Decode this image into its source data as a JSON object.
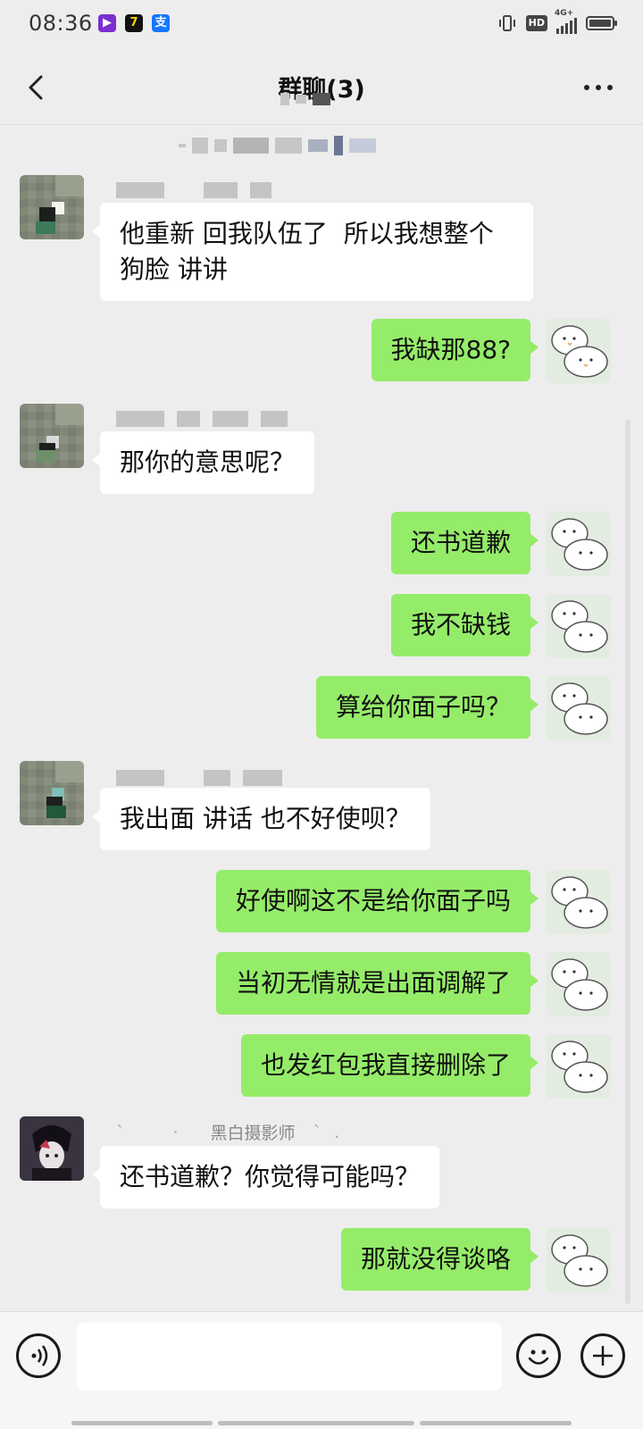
{
  "status_bar": {
    "time": "08:36",
    "app_icons": [
      "video-app-icon",
      "seven-app-icon",
      "alipay-icon"
    ],
    "indicators": [
      "vibrate-icon",
      "hd-icon",
      "4g-signal-icon",
      "battery-icon"
    ],
    "hd_label": "HD",
    "network_label": "4G+"
  },
  "header": {
    "title": "群聊(3)",
    "back_icon": "chevron-left-icon",
    "more_icon": "more-dots-icon"
  },
  "messages": [
    {
      "side": "in",
      "name_visible": false,
      "text": "他重新 回我队伍了  所以我想整个狗脸 讲讲"
    },
    {
      "side": "out",
      "text": "我缺那88?"
    },
    {
      "side": "in",
      "name_visible": false,
      "text": "那你的意思呢？"
    },
    {
      "side": "out",
      "text": "还书道歉"
    },
    {
      "side": "out",
      "text": "我不缺钱"
    },
    {
      "side": "out",
      "text": "算给你面子吗？"
    },
    {
      "side": "in",
      "name_visible": false,
      "text": "我出面 讲话 也不好使呗？"
    },
    {
      "side": "out",
      "text": "好使啊这不是给你面子吗"
    },
    {
      "side": "out",
      "text": "当初无情就是出面调解了"
    },
    {
      "side": "out",
      "text": "也发红包我直接删除了"
    },
    {
      "side": "in",
      "name": "黑白摄影师",
      "text": "还书道歉？你觉得可能吗？"
    },
    {
      "side": "out",
      "text": "那就没得谈咯"
    }
  ],
  "input_bar": {
    "voice_icon": "voice-icon",
    "input_placeholder": "",
    "emoji_icon": "emoji-icon",
    "plus_icon": "plus-icon"
  },
  "colors": {
    "background": "#ededed",
    "bubble_out": "#95ec69",
    "bubble_in": "#ffffff"
  }
}
